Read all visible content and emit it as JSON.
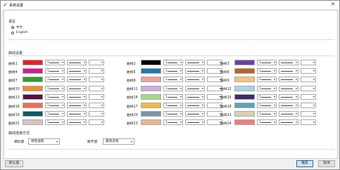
{
  "window": {
    "title": "系统设置",
    "close_glyph": "✕"
  },
  "language": {
    "title": "语言",
    "options": [
      {
        "label": "中文",
        "selected": true
      },
      {
        "label": "English",
        "selected": false
      }
    ]
  },
  "curves": {
    "title": "曲线设置",
    "items": [
      {
        "label": "曲线1",
        "color": "#e52222",
        "width": "1"
      },
      {
        "label": "曲线2",
        "color": "#000000",
        "width": "1"
      },
      {
        "label": "曲线3",
        "color": "#6b3fa0",
        "width": "1"
      },
      {
        "label": "曲线4",
        "color": "#d31b8e",
        "width": "1"
      },
      {
        "label": "曲线5",
        "color": "#1f78b4",
        "width": "1"
      },
      {
        "label": "曲线6",
        "color": "#b5652b",
        "width": "1"
      },
      {
        "label": "曲线7",
        "color": "#2ca02c",
        "width": "1"
      },
      {
        "label": "曲线8",
        "color": "#f4a0a0",
        "width": "1"
      },
      {
        "label": "曲线9",
        "color": "#fbc27d",
        "width": "1"
      },
      {
        "label": "曲线10",
        "color": "#f28a2a",
        "width": "1"
      },
      {
        "label": "曲线11",
        "color": "#c9aee0",
        "width": "1"
      },
      {
        "label": "曲线12",
        "color": "#a8d4ea",
        "width": "1"
      },
      {
        "label": "曲线13",
        "color": "#5a0f3c",
        "width": "1"
      },
      {
        "label": "曲线14",
        "color": "#a6d88a",
        "width": "1"
      },
      {
        "label": "曲线15",
        "color": "#3a2a6e",
        "width": "1"
      },
      {
        "label": "曲线16",
        "color": "#ee6f4f",
        "width": "1"
      },
      {
        "label": "曲线17",
        "color": "#f5b83a",
        "width": "1"
      },
      {
        "label": "曲线18",
        "color": "#5aa6b9",
        "width": "1"
      },
      {
        "label": "曲线19",
        "color": "#0f5a5e",
        "width": "1"
      },
      {
        "label": "曲线20",
        "color": "#7d94a6",
        "width": "1"
      },
      {
        "label": "曲线21",
        "color": "#d8d2a6",
        "width": "1"
      },
      {
        "label": "曲线22",
        "color": "#d9c2c2",
        "width": "1"
      },
      {
        "label": "曲线23",
        "color": "#f0b48a",
        "width": "1"
      },
      {
        "label": "曲线24",
        "color": "#f07e7e",
        "width": "1"
      }
    ]
  },
  "fit": {
    "title": "曲线连接方法",
    "analog_label": "模拟量",
    "analog_value": "线性插值",
    "digital_label": "数字量",
    "digital_value": "最接近值"
  },
  "footer": {
    "default_label": "默认值",
    "ok_label": "确定",
    "cancel_label": "取消"
  }
}
